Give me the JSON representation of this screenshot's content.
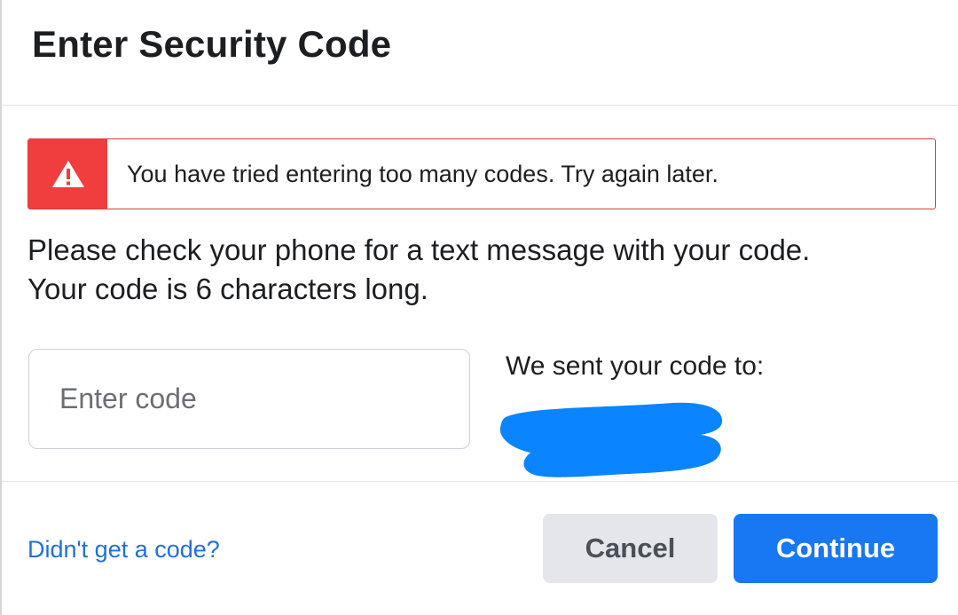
{
  "dialog": {
    "title": "Enter Security Code"
  },
  "alert": {
    "icon": "warning-triangle-icon",
    "message": "You have tried entering too many codes. Try again later.",
    "color": "#f03e3e"
  },
  "instructions": {
    "line1": "Please check your phone for a text message with your code.",
    "line2": "Your code is 6 characters long."
  },
  "code_input": {
    "placeholder": "Enter code",
    "value": ""
  },
  "sent_to": {
    "label": "We sent your code to:",
    "redaction_color": "#0a84ff"
  },
  "footer": {
    "resend_link": "Didn't get a code?",
    "cancel_label": "Cancel",
    "continue_label": "Continue",
    "accent_color": "#1877f2"
  }
}
